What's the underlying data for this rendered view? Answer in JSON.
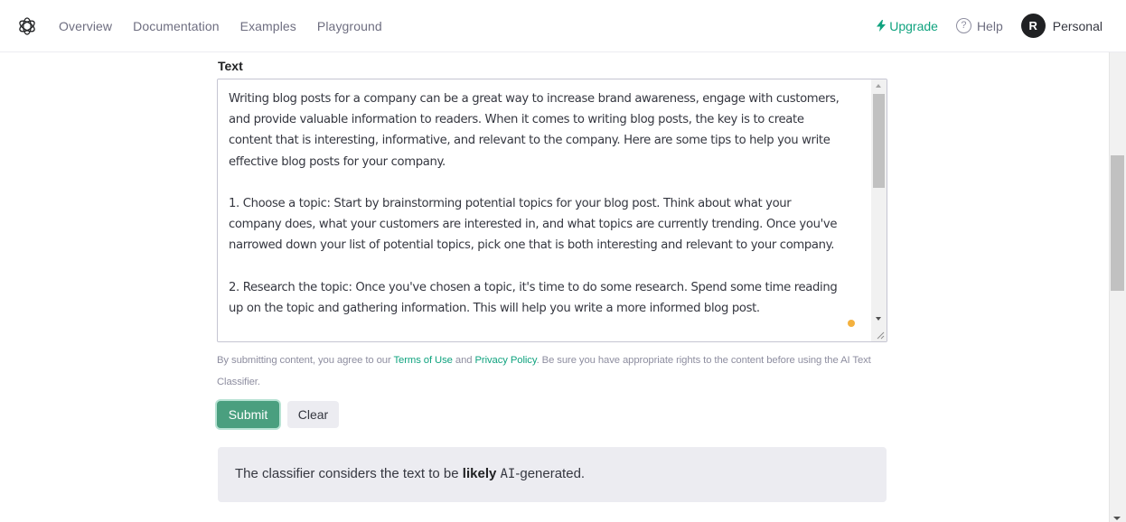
{
  "header": {
    "nav": [
      "Overview",
      "Documentation",
      "Examples",
      "Playground"
    ],
    "upgrade_label": "Upgrade",
    "help_label": "Help",
    "avatar_initial": "R",
    "account_label": "Personal",
    "accent_color": "#10a37f"
  },
  "form": {
    "field_label": "Text",
    "text_value": "Writing blog posts for a company can be a great way to increase brand awareness, engage with customers,\nand provide valuable information to readers. When it comes to writing blog posts, the key is to create\ncontent that is interesting, informative, and relevant to the company. Here are some tips to help you write\neffective blog posts for your company.\n\n1. Choose a topic: Start by brainstorming potential topics for your blog post. Think about what your\ncompany does, what your customers are interested in, and what topics are currently trending. Once you've\nnarrowed down your list of potential topics, pick one that is both interesting and relevant to your company.\n\n2. Research the topic: Once you've chosen a topic, it's time to do some research. Spend some time reading\nup on the topic and gathering information. This will help you write a more informed blog post.",
    "terms_prefix": "By submitting content, you agree to our ",
    "terms_link": "Terms of Use",
    "terms_and": " and ",
    "privacy_link": "Privacy Policy",
    "terms_suffix": ". Be sure you have appropriate rights to the content before using the AI Text Classifier.",
    "submit_label": "Submit",
    "clear_label": "Clear"
  },
  "result": {
    "prefix": "The classifier considers the text to be ",
    "verdict": "likely",
    "space": " ",
    "ai_term": "AI",
    "suffix": "-generated."
  }
}
